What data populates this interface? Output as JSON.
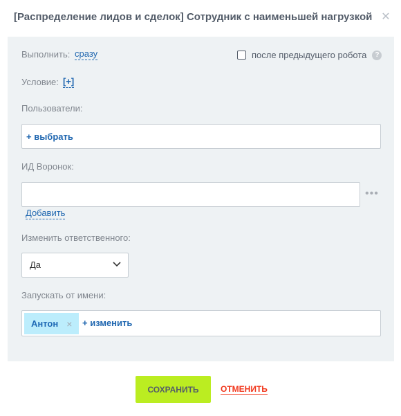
{
  "dialog": {
    "title": "[Распределение лидов и сделок] Сотрудник с наименьшей нагрузкой",
    "close_icon": "close-icon"
  },
  "execute": {
    "label": "Выполнить:",
    "value": "сразу",
    "after_previous_label": "после предыдущего робота",
    "after_previous_checked": false,
    "help_icon_text": "?"
  },
  "condition": {
    "label": "Условие:",
    "add": "[+]"
  },
  "users": {
    "label": "Пользователи:",
    "select": "+ выбрать"
  },
  "funnels": {
    "label": "ИД Воронок:",
    "value": "",
    "add": "Добавить",
    "more_icon": "•••"
  },
  "change_responsible": {
    "label": "Изменить ответственного:",
    "selected": "Да"
  },
  "run_as": {
    "label": "Запускать от имени:",
    "user": "Антон",
    "remove_icon": "×",
    "change": "+ изменить"
  },
  "footer": {
    "save": "СОХРАНИТЬ",
    "cancel": "ОТМЕНИТЬ"
  },
  "colors": {
    "panel_bg": "#eef2f4",
    "link": "#2067b0",
    "save_bg": "#bbed21",
    "cancel": "#f1361b",
    "tag_bg": "#bcedfc"
  }
}
